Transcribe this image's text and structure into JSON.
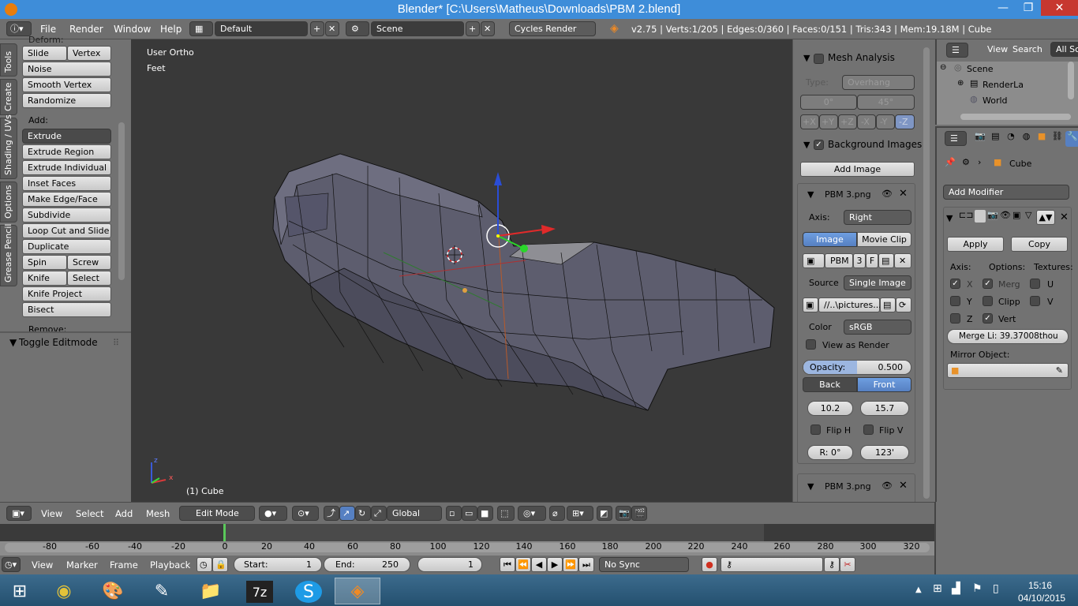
{
  "window": {
    "title": "Blender* [C:\\Users\\Matheus\\Downloads\\PBM 2.blend]",
    "minimize": "—",
    "maximize": "❐",
    "close": "✕"
  },
  "menubar": {
    "items": [
      "File",
      "Render",
      "Window",
      "Help"
    ],
    "layout": "Default",
    "scene": "Scene",
    "engine": "Cycles Render",
    "stats": "v2.75 | Verts:1/205 | Edges:0/360 | Faces:0/151 | Tris:343 | Mem:19.18M | Cube"
  },
  "vtabs": [
    "Tools",
    "Create",
    "Shading / UVs",
    "Options",
    "Grease Pencil"
  ],
  "tools": {
    "top_cut": "Deform:",
    "row1": [
      "Slide Edg",
      "Vertex"
    ],
    "buttons_a": [
      "Noise",
      "Smooth Vertex",
      "Randomize"
    ],
    "add_label": "Add:",
    "extrude": "Extrude",
    "buttons_b": [
      "Extrude Region",
      "Extrude Individual",
      "Inset Faces",
      "Make Edge/Face",
      "Subdivide",
      "Loop Cut and Slide",
      "Duplicate"
    ],
    "row_spin": [
      "Spin",
      "Screw"
    ],
    "row_knife": [
      "Knife",
      "Select"
    ],
    "buttons_c": [
      "Knife Project",
      "Bisect"
    ],
    "remove_label": "Remove:",
    "toggle": "Toggle Editmode"
  },
  "viewport": {
    "view_name": "User Ortho",
    "units": "Feet",
    "object_label": "(1) Cube",
    "axis_x": "x",
    "axis_z": "z"
  },
  "properties_n": {
    "mesh_analysis": "Mesh Analysis",
    "type_label": "Type:",
    "type_value": "Overhang",
    "angle_min": "0°",
    "angle_max": "45°",
    "axis_buttons": [
      "+X",
      "+Y",
      "+Z",
      "-X",
      "-Y",
      "-Z"
    ],
    "background_images": "Background Images",
    "add_image": "Add Image",
    "image_name": "PBM 3.png",
    "axis_label": "Axis:",
    "axis_value": "Right",
    "tab_image": "Image",
    "tab_clip": "Movie Clip",
    "img_field": "PBM",
    "img_users": "3",
    "img_f": "F",
    "source_label": "Source",
    "source_value": "Single Image",
    "path": "//..\\pictures...",
    "color_label": "Color",
    "color_value": "sRGB",
    "view_as_render": "View as Render",
    "opacity": "Opacity:",
    "opacity_value": "0.500",
    "back": "Back",
    "front": "Front",
    "x_value": "10.2",
    "y_value": "15.7",
    "flip_h": "Flip H",
    "flip_v": "Flip V",
    "rotation": "R: 0°",
    "size_value": "123'",
    "image_name_2": "PBM 3.png"
  },
  "outliner": {
    "menus": [
      "View",
      "Search",
      "All Sc"
    ],
    "items": [
      "Scene",
      "RenderLa",
      "World"
    ]
  },
  "props": {
    "object_name": "Cube",
    "add_modifier": "Add Modifier",
    "apply": "Apply",
    "copy": "Copy",
    "axis_label": "Axis:",
    "options_label": "Options:",
    "textures_label": "Textures:",
    "axes": [
      "X",
      "Y",
      "Z"
    ],
    "options": [
      "Merg",
      "Clipp",
      "Vert"
    ],
    "textures": [
      "U",
      "V"
    ],
    "merge_limit": "Merge Li: 39.37008thou",
    "mirror_object": "Mirror Object:"
  },
  "viewheader": {
    "menus": [
      "View",
      "Select",
      "Add",
      "Mesh"
    ],
    "mode": "Edit Mode",
    "orientation": "Global"
  },
  "timeline": {
    "ticks": [
      "-80",
      "-60",
      "-40",
      "-20",
      "0",
      "20",
      "40",
      "60",
      "80",
      "100",
      "120",
      "140",
      "160",
      "180",
      "200",
      "220",
      "240",
      "260",
      "280",
      "300",
      "320"
    ],
    "menus": [
      "View",
      "Marker",
      "Frame",
      "Playback"
    ],
    "start": "Start:",
    "start_value": "1",
    "end": "End:",
    "end_value": "250",
    "current": "1",
    "sync": "No Sync"
  },
  "taskbar": {
    "time": "15:16",
    "date": "04/10/2015"
  },
  "colors": {
    "title": "#3e8dd9",
    "viewport": "#393939",
    "panel": "#727272",
    "accent": "#5680c2"
  }
}
